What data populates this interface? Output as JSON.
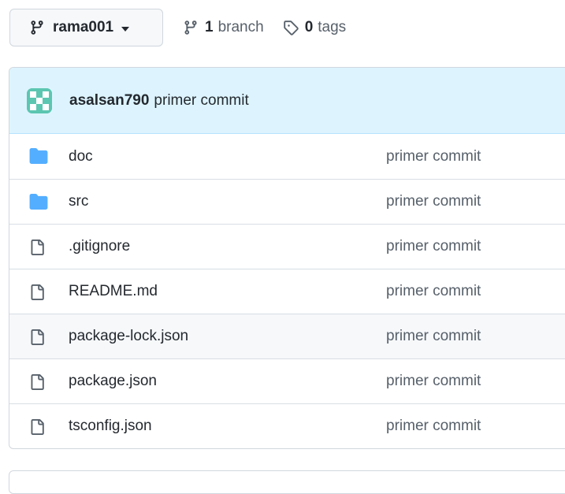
{
  "branch_selector": {
    "label": "rama001",
    "icon": "git-branch-icon"
  },
  "branches_link": {
    "count": "1",
    "label": "branch",
    "icon": "git-branch-icon"
  },
  "tags_link": {
    "count": "0",
    "label": "tags",
    "icon": "tag-icon"
  },
  "latest_commit": {
    "author": "asalsan790",
    "message": "primer commit"
  },
  "files": [
    {
      "name": "doc",
      "type": "folder",
      "commit": "primer commit"
    },
    {
      "name": "src",
      "type": "folder",
      "commit": "primer commit"
    },
    {
      "name": ".gitignore",
      "type": "file",
      "commit": "primer commit"
    },
    {
      "name": "README.md",
      "type": "file",
      "commit": "primer commit"
    },
    {
      "name": "package-lock.json",
      "type": "file",
      "commit": "primer commit"
    },
    {
      "name": "package.json",
      "type": "file",
      "commit": "primer commit"
    },
    {
      "name": "tsconfig.json",
      "type": "file",
      "commit": "primer commit"
    }
  ],
  "colors": {
    "folder": "#54aeff",
    "header_bg": "#ddf4ff",
    "muted_text": "#57606a"
  }
}
